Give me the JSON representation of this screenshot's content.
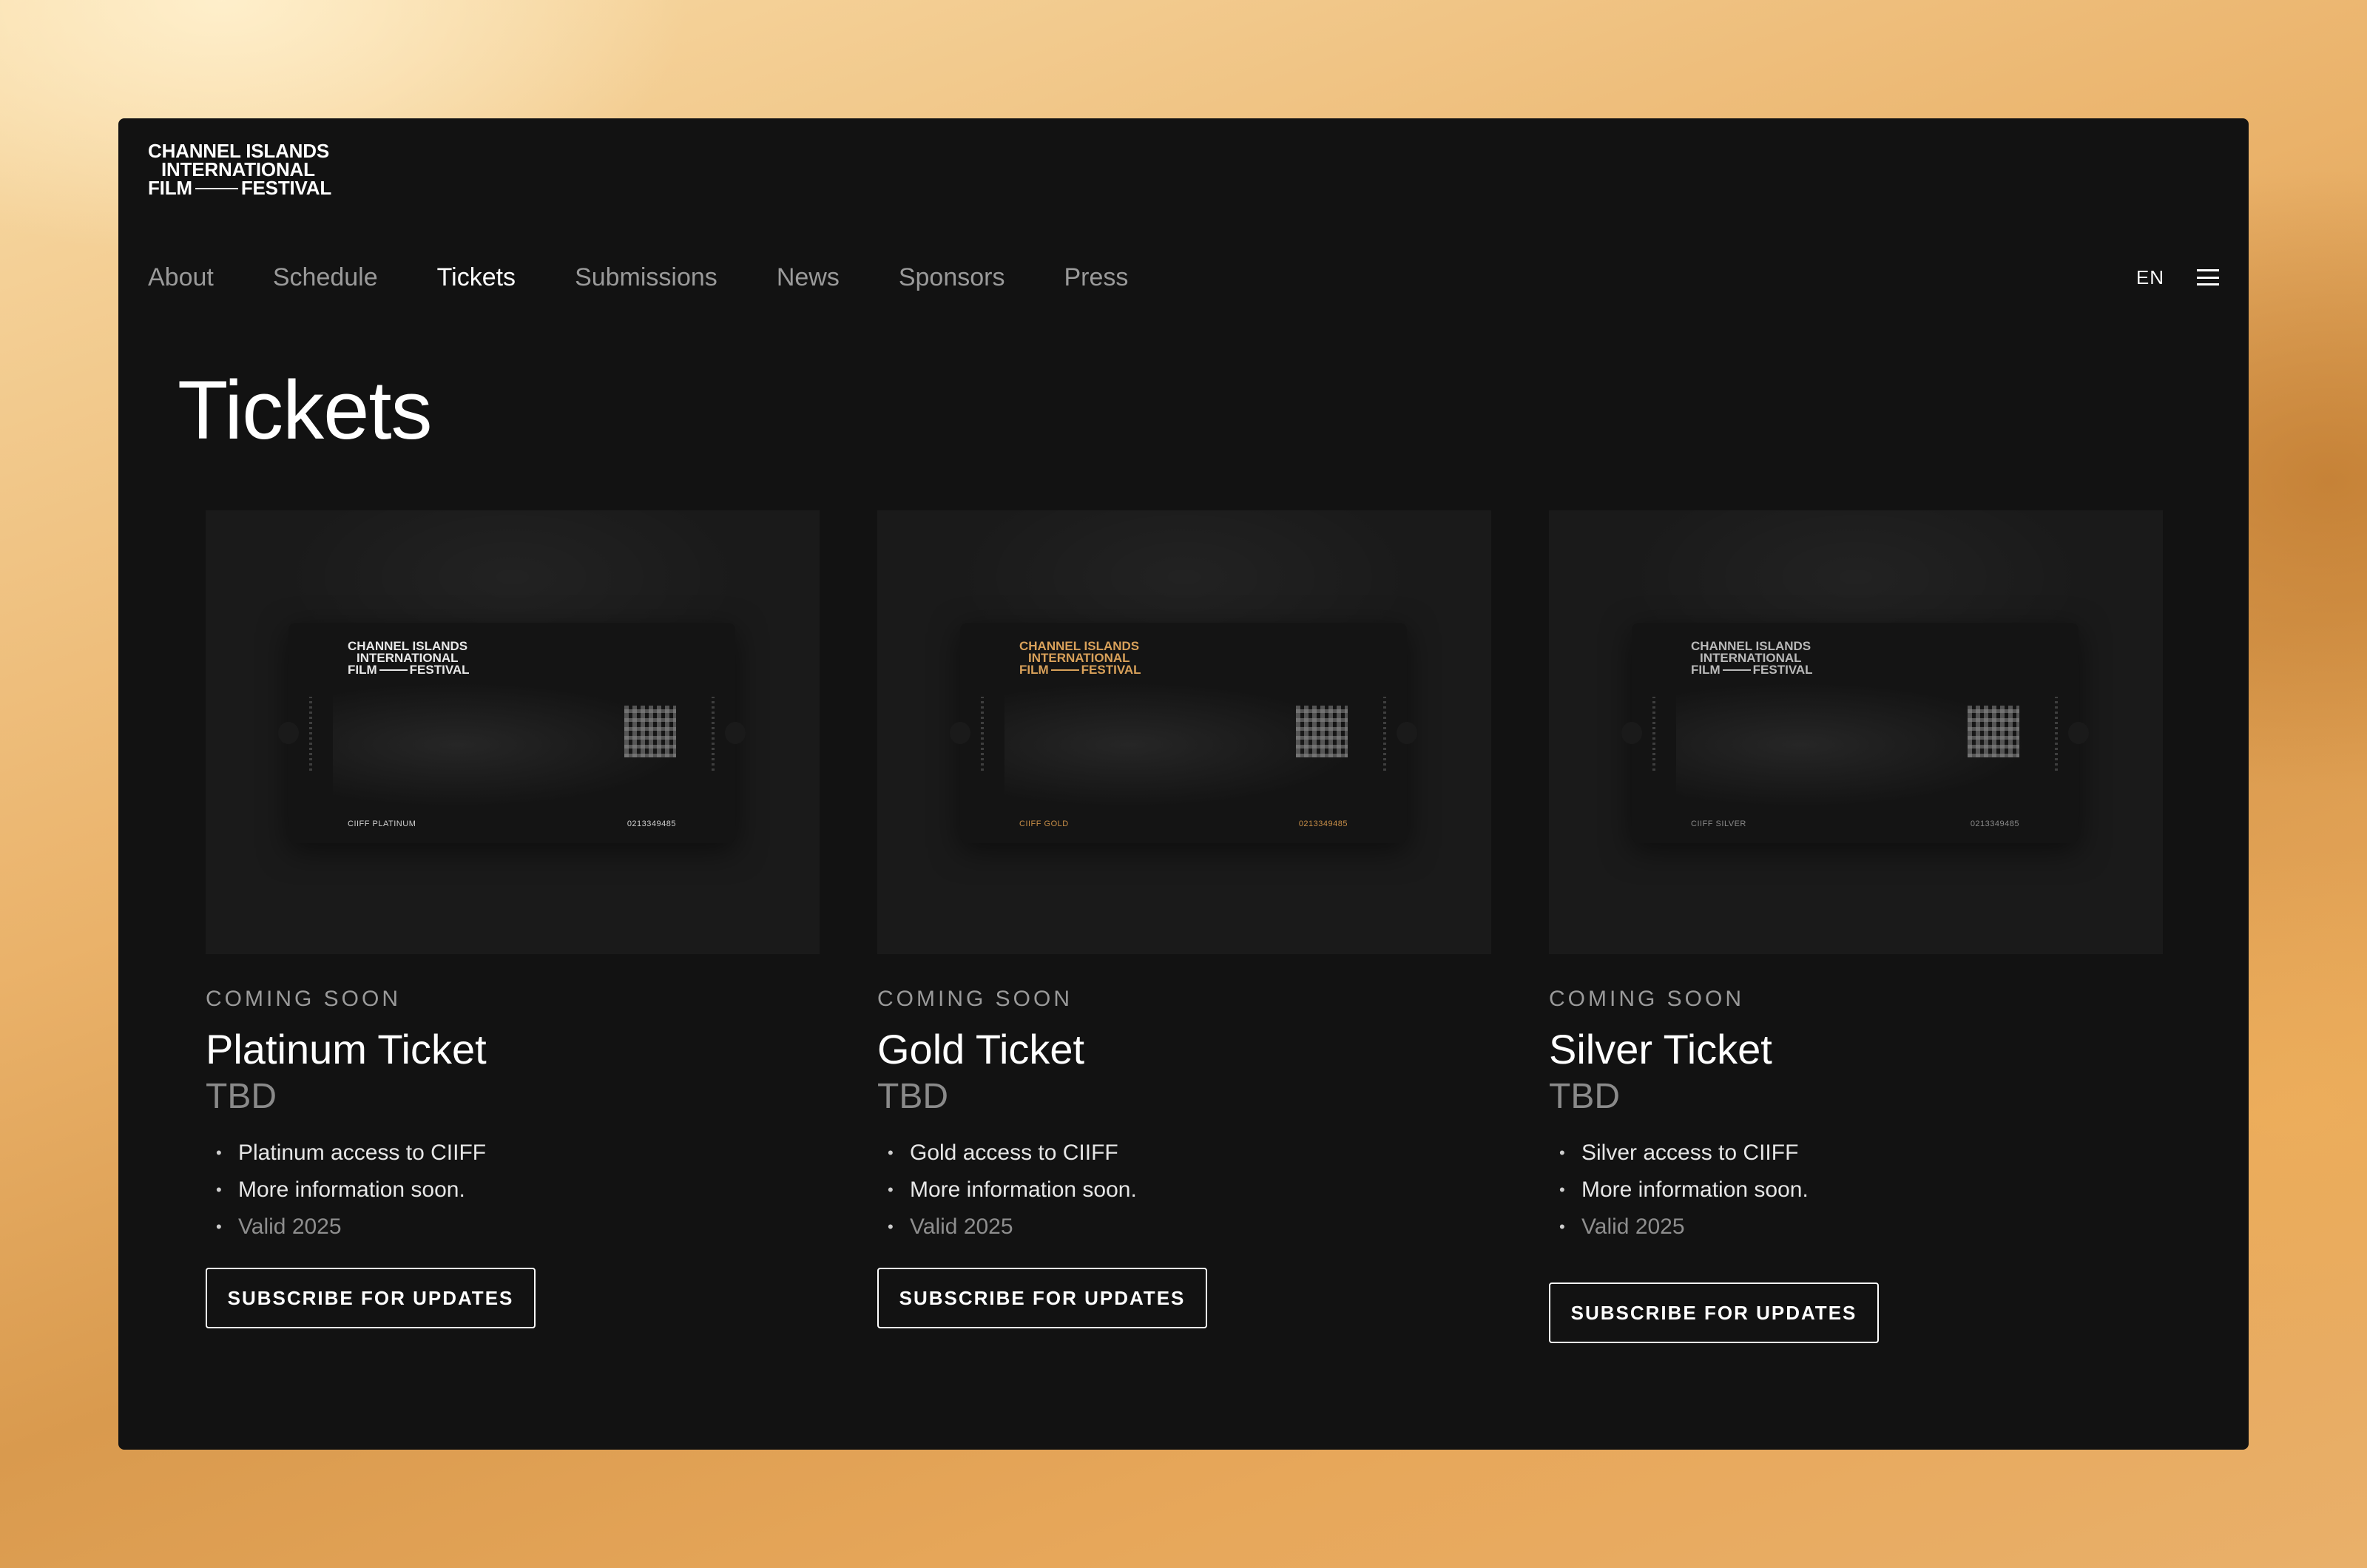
{
  "header": {
    "logo": {
      "line1": "CHANNEL ISLANDS",
      "line2": "INTERNATIONAL",
      "line3_left": "FILM",
      "line3_right": "FESTIVAL"
    },
    "nav": [
      {
        "label": "About"
      },
      {
        "label": "Schedule"
      },
      {
        "label": "Tickets"
      },
      {
        "label": "Submissions"
      },
      {
        "label": "News"
      },
      {
        "label": "Sponsors"
      },
      {
        "label": "Press"
      }
    ],
    "active_nav": "Tickets",
    "language": "EN",
    "menu_icon": "hamburger-menu-icon"
  },
  "page": {
    "title": "Tickets"
  },
  "tickets": [
    {
      "status": "COMING SOON",
      "name": "Platinum Ticket",
      "price": "TBD",
      "features": [
        "Platinum access to CIIFF",
        "More information soon.",
        "Valid 2025"
      ],
      "button": "SUBSCRIBE FOR UPDATES",
      "visual": {
        "logo_line1": "CHANNEL ISLANDS",
        "logo_line2": "INTERNATIONAL",
        "logo_line3_left": "FILM",
        "logo_line3_right": "FESTIVAL",
        "tier_label": "CIIFF PLATINUM",
        "serial": "0213349485",
        "accent": "#e8e8e8"
      }
    },
    {
      "status": "COMING SOON",
      "name": "Gold Ticket",
      "price": "TBD",
      "features": [
        "Gold access to CIIFF",
        "More information soon.",
        "Valid 2025"
      ],
      "button": "SUBSCRIBE FOR UPDATES",
      "visual": {
        "logo_line1": "CHANNEL ISLANDS",
        "logo_line2": "INTERNATIONAL",
        "logo_line3_left": "FILM",
        "logo_line3_right": "FESTIVAL",
        "tier_label": "CIIFF GOLD",
        "serial": "0213349485",
        "accent": "#d9a15a"
      }
    },
    {
      "status": "COMING SOON",
      "name": "Silver Ticket",
      "price": "TBD",
      "features": [
        "Silver access to CIIFF",
        "More information soon.",
        "Valid 2025"
      ],
      "button": "SUBSCRIBE FOR UPDATES",
      "visual": {
        "logo_line1": "CHANNEL ISLANDS",
        "logo_line2": "INTERNATIONAL",
        "logo_line3_left": "FILM",
        "logo_line3_right": "FESTIVAL",
        "tier_label": "CIIFF SILVER",
        "serial": "0213349485",
        "accent": "#b9b9b9"
      }
    }
  ],
  "colors": {
    "window_bg": "#121212",
    "card_visual_bg": "#1a1a1a",
    "nav_inactive": "#9a9a9a",
    "nav_active": "#ffffff",
    "backdrop_gold": "#eab26a"
  }
}
